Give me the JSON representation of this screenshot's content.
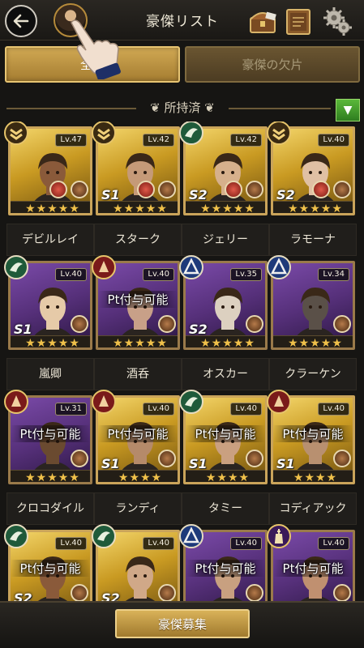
{
  "header": {
    "title": "豪傑リスト"
  },
  "tabs": [
    {
      "label": "全て",
      "active": true
    },
    {
      "label": "豪傑の欠片",
      "active": false
    }
  ],
  "section": {
    "label": "所持済",
    "filter_glyph": "▼"
  },
  "heroes": [
    {
      "name": "デビルレイ",
      "level": "Lv.47",
      "tier": "",
      "frame": "gold",
      "badge": "chevron",
      "stars": "★★★★★",
      "pt": ""
    },
    {
      "name": "スターク",
      "level": "Lv.42",
      "tier": "S1",
      "frame": "gold",
      "badge": "chevron",
      "stars": "★★★★★",
      "pt": ""
    },
    {
      "name": "ジェリー",
      "level": "Lv.42",
      "tier": "S2",
      "frame": "gold",
      "badge": "green",
      "stars": "★★★★★",
      "pt": ""
    },
    {
      "name": "ラモーナ",
      "level": "Lv.40",
      "tier": "S2",
      "frame": "gold",
      "badge": "chevron",
      "stars": "★★★★★",
      "pt": ""
    },
    {
      "name": "嵐卿",
      "level": "Lv.40",
      "tier": "S1",
      "frame": "purple",
      "badge": "green",
      "stars": "★★★★★",
      "pt": ""
    },
    {
      "name": "酒呑",
      "level": "Lv.40",
      "tier": "",
      "frame": "purple",
      "badge": "red",
      "stars": "★★★★★",
      "pt": "Pt付与可能"
    },
    {
      "name": "オスカー",
      "level": "Lv.35",
      "tier": "S2",
      "frame": "purple",
      "badge": "blue",
      "stars": "★★★★★",
      "pt": ""
    },
    {
      "name": "クラーケン",
      "level": "Lv.34",
      "tier": "",
      "frame": "purple",
      "badge": "blue",
      "stars": "★★★★★",
      "pt": ""
    },
    {
      "name": "クロコダイル",
      "level": "Lv.31",
      "tier": "",
      "frame": "purple",
      "badge": "red",
      "stars": "★★★★★",
      "pt": "Pt付与可能"
    },
    {
      "name": "ランディ",
      "level": "Lv.40",
      "tier": "S1",
      "frame": "gold",
      "badge": "red",
      "stars": "★★★★",
      "pt": "Pt付与可能"
    },
    {
      "name": "タミー",
      "level": "Lv.40",
      "tier": "S1",
      "frame": "gold",
      "badge": "green",
      "stars": "★★★★",
      "pt": "Pt付与可能"
    },
    {
      "name": "コディアック",
      "level": "Lv.40",
      "tier": "S1",
      "frame": "gold",
      "badge": "red",
      "stars": "★★★★",
      "pt": "Pt付与可能"
    },
    {
      "name": "",
      "level": "Lv.40",
      "tier": "S2",
      "frame": "gold",
      "badge": "green",
      "stars": "",
      "pt": "Pt付与可能"
    },
    {
      "name": "",
      "level": "Lv.40",
      "tier": "S2",
      "frame": "gold",
      "badge": "green",
      "stars": "",
      "pt": ""
    },
    {
      "name": "",
      "level": "Lv.40",
      "tier": "",
      "frame": "purple",
      "badge": "blue",
      "stars": "",
      "pt": "Pt付与可能"
    },
    {
      "name": "",
      "level": "Lv.40",
      "tier": "",
      "frame": "purple",
      "badge": "king",
      "stars": "",
      "pt": "Pt付与可能"
    }
  ],
  "footer": {
    "recruit_label": "豪傑募集"
  },
  "colors": {
    "gold_frame": "#caa45a",
    "purple_frame": "#56307a",
    "star": "#f0c14a",
    "filter_green": "#5ab83a"
  }
}
